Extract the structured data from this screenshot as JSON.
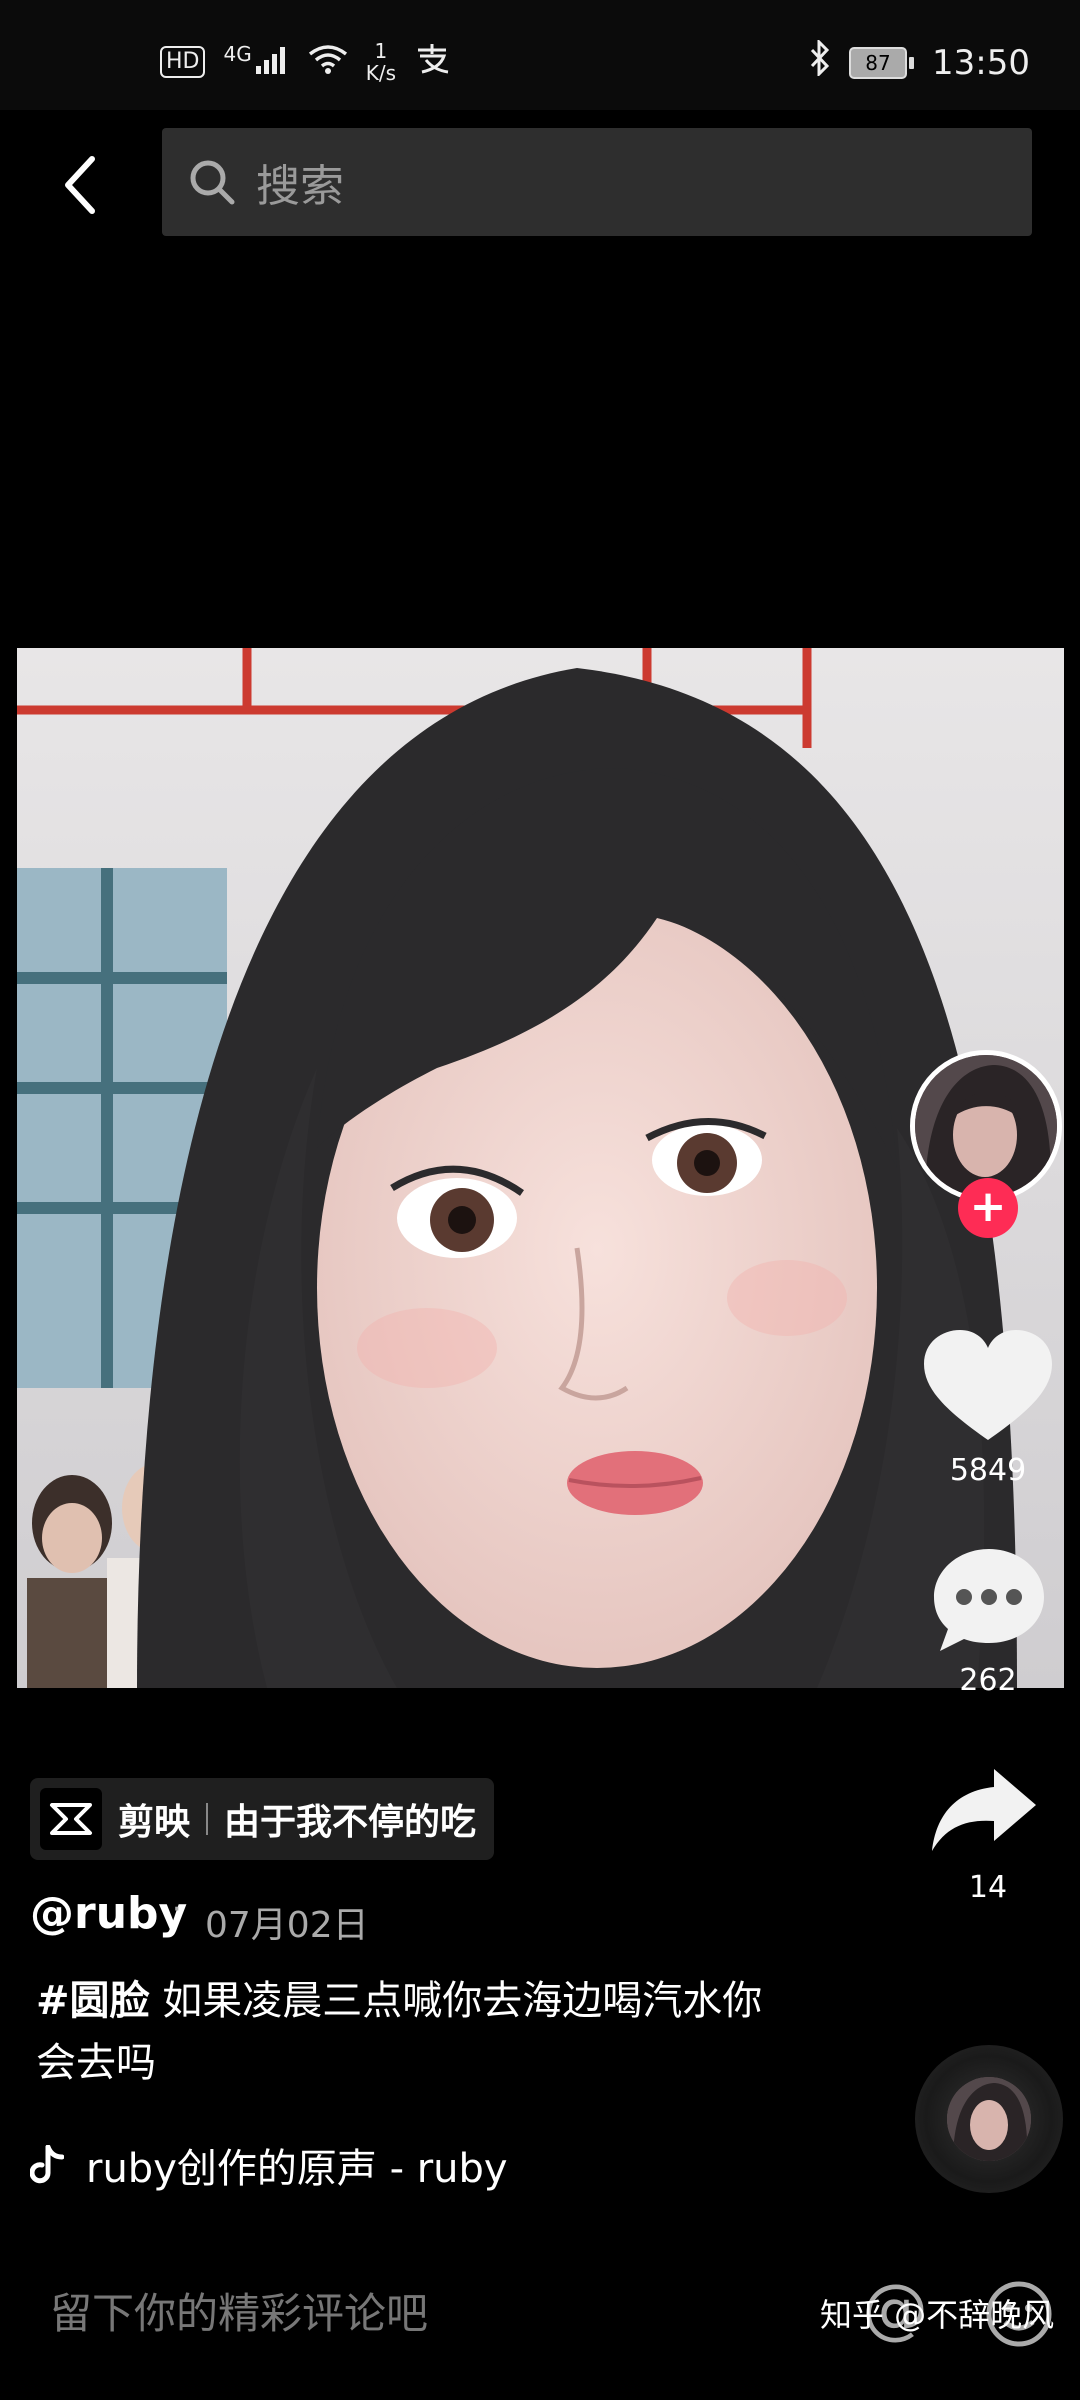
{
  "status_bar": {
    "network": "4G",
    "hd": "HD",
    "speed_value": "1",
    "speed_unit": "K/s",
    "battery": "87",
    "time": "13:50"
  },
  "search": {
    "placeholder": "搜索"
  },
  "video": {
    "likes": "5849",
    "comments": "262",
    "shares": "14"
  },
  "capcut": {
    "app_name": "剪映",
    "template_title": "由于我不停的吃"
  },
  "post": {
    "author": "@ruby",
    "date": "07月02日",
    "hashtag": "#圆脸",
    "caption": " 如果凌晨三点喊你去海边喝汽水你会去吗"
  },
  "music": {
    "label": "ruby创作的原声 - ruby"
  },
  "comment_bar": {
    "placeholder": "留下你的精彩评论吧"
  },
  "watermark": "知乎 @不辞晚风",
  "colors": {
    "accent": "#fe2c55",
    "background": "#000000"
  }
}
